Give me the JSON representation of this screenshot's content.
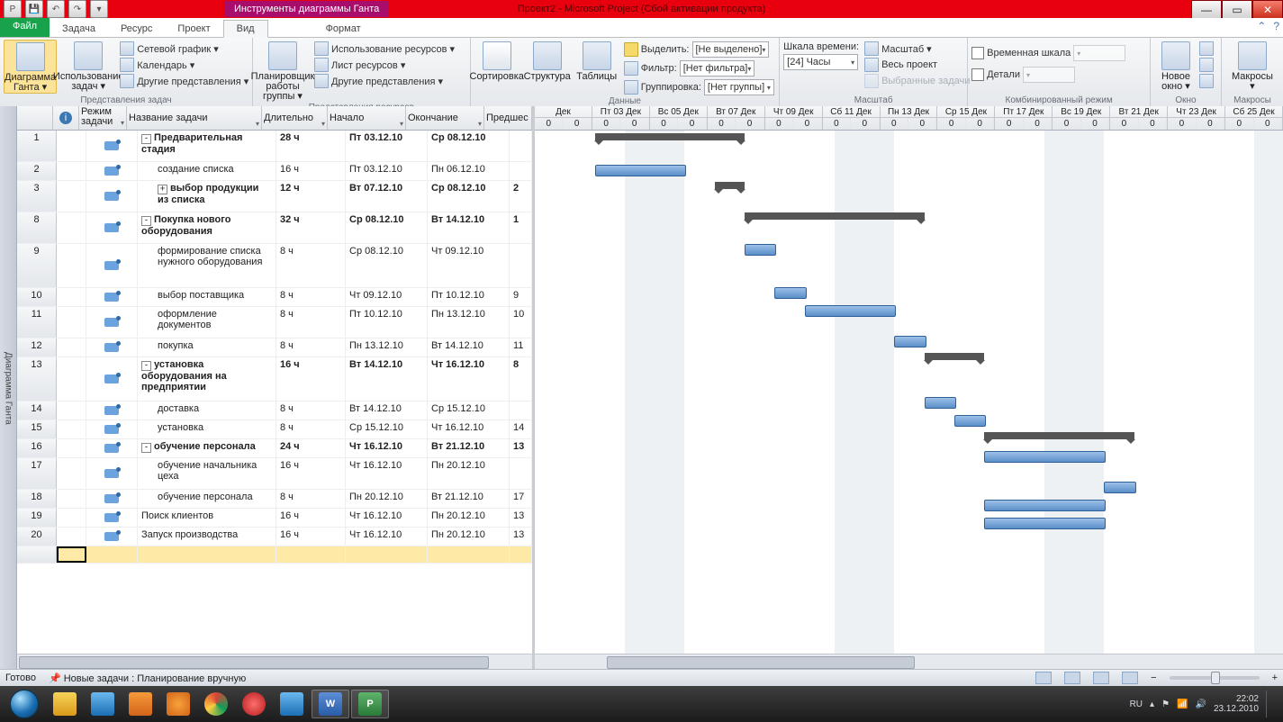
{
  "window": {
    "title": "Проект2 - Microsoft Project (Сбой активации продукта)",
    "context_tab": "Инструменты диаграммы Ганта",
    "tabs": {
      "file": "Файл",
      "task": "Задача",
      "resource": "Ресурс",
      "project": "Проект",
      "view": "Вид",
      "format": "Формат"
    }
  },
  "ribbon": {
    "group_views_label": "Представления задач",
    "gantt_btn_l1": "Диаграмма",
    "gantt_btn_l2": "Ганта ▾",
    "usage_btn_l1": "Использование",
    "usage_btn_l2": "задач ▾",
    "network": "Сетевой график ▾",
    "calendar": "Календарь ▾",
    "other_views": "Другие представления ▾",
    "group_res_label": "Представления ресурсов",
    "teamplanner_l1": "Планировщик",
    "teamplanner_l2": "работы группы ▾",
    "res_usage": "Использование ресурсов ▾",
    "res_sheet": "Лист ресурсов ▾",
    "res_other": "Другие представления ▾",
    "group_data_label": "Данные",
    "sort": "Сортировка",
    "outline": "Структура",
    "tables": "Таблицы",
    "highlight_lbl": "Выделить:",
    "highlight_val": "[Не выделено]",
    "filter_lbl": "Фильтр:",
    "filter_val": "[Нет фильтра]",
    "group_lbl": "Группировка:",
    "group_val": "[Нет группы]",
    "group_scale_label": "Масштаб",
    "timescale_lbl": "Шкала времени:",
    "timescale_val": "[24] Часы",
    "zoom_lbl": "Масштаб ▾",
    "entire": "Весь проект",
    "selected": "Выбранные задачи",
    "group_split_label": "Комбинированный режим",
    "timeline": "Временная шкала",
    "details": "Детали",
    "group_window_label": "Окно",
    "new_window_l1": "Новое",
    "new_window_l2": "окно ▾",
    "group_macro_label": "Макросы",
    "macros_l1": "Макросы",
    "macros_l2": "▾"
  },
  "side_label": "Диаграмма Ганта",
  "columns": {
    "info": "i",
    "mode_l1": "Режим",
    "mode_l2": "задачи",
    "name": "Название задачи",
    "duration": "Длительно",
    "start": "Начало",
    "finish": "Окончание",
    "pred": "Предшес"
  },
  "timeline_days": [
    "Дек",
    "Пт 03 Дек",
    "Вс 05 Дек",
    "Вт 07 Дек",
    "Чт 09 Дек",
    "Сб 11 Дек",
    "Пн 13 Дек",
    "Ср 15 Дек",
    "Пт 17 Дек",
    "Вс 19 Дек",
    "Вт 21 Дек",
    "Чт 23 Дек",
    "Сб 25 Дек"
  ],
  "hour_row": [
    "0",
    "0"
  ],
  "tasks": [
    {
      "n": "1",
      "name": "Предварительная стадия",
      "dur": "28 ч",
      "start": "Пт 03.12.10",
      "finish": "Ср 08.12.10",
      "pred": "",
      "sum": true,
      "ind": 0,
      "tog": "-"
    },
    {
      "n": "2",
      "name": "создание списка",
      "dur": "16 ч",
      "start": "Пт 03.12.10",
      "finish": "Пн 06.12.10",
      "pred": "",
      "sum": false,
      "ind": 1
    },
    {
      "n": "3",
      "name": "выбор продукции из списка",
      "dur": "12 ч",
      "start": "Вт 07.12.10",
      "finish": "Ср 08.12.10",
      "pred": "2",
      "sum": true,
      "ind": 1,
      "tog": "+"
    },
    {
      "n": "8",
      "name": "Покупка нового оборудования",
      "dur": "32 ч",
      "start": "Ср 08.12.10",
      "finish": "Вт 14.12.10",
      "pred": "1",
      "sum": true,
      "ind": 0,
      "tog": "-"
    },
    {
      "n": "9",
      "name": "формирование списка нужного оборудования",
      "dur": "8 ч",
      "start": "Ср 08.12.10",
      "finish": "Чт 09.12.10",
      "pred": "",
      "sum": false,
      "ind": 1
    },
    {
      "n": "10",
      "name": "выбор поставщика",
      "dur": "8 ч",
      "start": "Чт 09.12.10",
      "finish": "Пт 10.12.10",
      "pred": "9",
      "sum": false,
      "ind": 1
    },
    {
      "n": "11",
      "name": "оформление документов",
      "dur": "8 ч",
      "start": "Пт 10.12.10",
      "finish": "Пн 13.12.10",
      "pred": "10",
      "sum": false,
      "ind": 1
    },
    {
      "n": "12",
      "name": "покупка",
      "dur": "8 ч",
      "start": "Пн 13.12.10",
      "finish": "Вт 14.12.10",
      "pred": "11",
      "sum": false,
      "ind": 1
    },
    {
      "n": "13",
      "name": "установка оборудования на предприятии",
      "dur": "16 ч",
      "start": "Вт 14.12.10",
      "finish": "Чт 16.12.10",
      "pred": "8",
      "sum": true,
      "ind": 0,
      "tog": "-"
    },
    {
      "n": "14",
      "name": "доставка",
      "dur": "8 ч",
      "start": "Вт 14.12.10",
      "finish": "Ср 15.12.10",
      "pred": "",
      "sum": false,
      "ind": 1
    },
    {
      "n": "15",
      "name": "установка",
      "dur": "8 ч",
      "start": "Ср 15.12.10",
      "finish": "Чт 16.12.10",
      "pred": "14",
      "sum": false,
      "ind": 1
    },
    {
      "n": "16",
      "name": "обучение персонала",
      "dur": "24 ч",
      "start": "Чт 16.12.10",
      "finish": "Вт 21.12.10",
      "pred": "13",
      "sum": true,
      "ind": 0,
      "tog": "-"
    },
    {
      "n": "17",
      "name": "обучение начальника цеха",
      "dur": "16 ч",
      "start": "Чт 16.12.10",
      "finish": "Пн 20.12.10",
      "pred": "",
      "sum": false,
      "ind": 1
    },
    {
      "n": "18",
      "name": "обучение персонала",
      "dur": "8 ч",
      "start": "Пн 20.12.10",
      "finish": "Вт 21.12.10",
      "pred": "17",
      "sum": false,
      "ind": 1
    },
    {
      "n": "19",
      "name": "Поиск клиентов",
      "dur": "16 ч",
      "start": "Чт 16.12.10",
      "finish": "Пн 20.12.10",
      "pred": "13",
      "sum": false,
      "ind": 0
    },
    {
      "n": "20",
      "name": "Запуск производства",
      "dur": "16 ч",
      "start": "Чт 16.12.10",
      "finish": "Пн 20.12.10",
      "pred": "13",
      "sum": false,
      "ind": 0
    }
  ],
  "chart_data": {
    "type": "bar",
    "title": "Gantt chart",
    "x_unit": "date",
    "series": [
      {
        "name": "Предварительная стадия",
        "type": "summary",
        "start": "2010-12-03",
        "finish": "2010-12-08"
      },
      {
        "name": "создание списка",
        "type": "task",
        "start": "2010-12-03",
        "finish": "2010-12-06"
      },
      {
        "name": "выбор продукции из списка",
        "type": "summary",
        "start": "2010-12-07",
        "finish": "2010-12-08"
      },
      {
        "name": "Покупка нового оборудования",
        "type": "summary",
        "start": "2010-12-08",
        "finish": "2010-12-14"
      },
      {
        "name": "формирование списка нужного оборудования",
        "type": "task",
        "start": "2010-12-08",
        "finish": "2010-12-09"
      },
      {
        "name": "выбор поставщика",
        "type": "task",
        "start": "2010-12-09",
        "finish": "2010-12-10"
      },
      {
        "name": "оформление документов",
        "type": "task",
        "start": "2010-12-10",
        "finish": "2010-12-13"
      },
      {
        "name": "покупка",
        "type": "task",
        "start": "2010-12-13",
        "finish": "2010-12-14"
      },
      {
        "name": "установка оборудования на предприятии",
        "type": "summary",
        "start": "2010-12-14",
        "finish": "2010-12-16"
      },
      {
        "name": "доставка",
        "type": "task",
        "start": "2010-12-14",
        "finish": "2010-12-15"
      },
      {
        "name": "установка",
        "type": "task",
        "start": "2010-12-15",
        "finish": "2010-12-16"
      },
      {
        "name": "обучение персонала",
        "type": "summary",
        "start": "2010-12-16",
        "finish": "2010-12-21"
      },
      {
        "name": "обучение начальника цеха",
        "type": "task",
        "start": "2010-12-16",
        "finish": "2010-12-20"
      },
      {
        "name": "обучение персонала",
        "type": "task",
        "start": "2010-12-20",
        "finish": "2010-12-21"
      },
      {
        "name": "Поиск клиентов",
        "type": "task",
        "start": "2010-12-16",
        "finish": "2010-12-20"
      },
      {
        "name": "Запуск производства",
        "type": "task",
        "start": "2010-12-16",
        "finish": "2010-12-20"
      }
    ],
    "weekends": [
      "2010-12-04",
      "2010-12-05",
      "2010-12-11",
      "2010-12-12",
      "2010-12-18",
      "2010-12-19",
      "2010-12-25"
    ]
  },
  "statusbar": {
    "ready": "Готово",
    "newtasks": "Новые задачи : Планирование вручную"
  },
  "tray": {
    "lang": "RU",
    "time": "22:02",
    "date": "23.12.2010"
  }
}
